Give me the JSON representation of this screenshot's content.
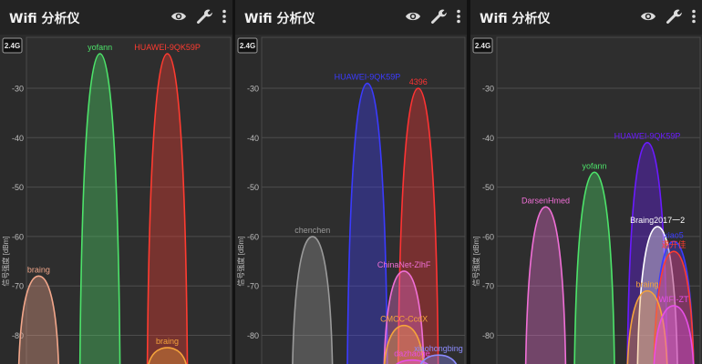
{
  "app": {
    "title": "Wifi 分析仪"
  },
  "toolbar_icons": [
    "eye-icon",
    "wrench-icon",
    "more-vert-icon"
  ],
  "band_label": "2.4G",
  "axis": {
    "ylabel": "信号强度 [dBm]",
    "ticks": [
      "-30",
      "-40",
      "-50",
      "-60",
      "-70",
      "-80"
    ]
  },
  "screens": [
    {
      "networks": [
        {
          "name": "braing",
          "dbm": -68,
          "color": "#f3a78b",
          "center": 0.06
        },
        {
          "name": "yofann",
          "dbm": -23,
          "color": "#4de36a",
          "center": 0.36
        },
        {
          "name": "HUAWEI-9QK59P",
          "dbm": -23,
          "color": "#ff3b30",
          "center": 0.69
        },
        {
          "name": "braing",
          "dbm": -82.5,
          "color": "#f5a33b",
          "center": 0.69
        }
      ]
    },
    {
      "networks": [
        {
          "name": "chenchen",
          "dbm": -60,
          "color": "#9a9a9a",
          "center": 0.25
        },
        {
          "name": "HUAWEI-9QK59P",
          "dbm": -29,
          "color": "#3b3bff",
          "center": 0.52
        },
        {
          "name": "4396",
          "dbm": -30,
          "color": "#ff3333",
          "center": 0.77
        },
        {
          "name": "ChinaNet-ZlhF",
          "dbm": -67,
          "color": "#f06fd6",
          "center": 0.7
        },
        {
          "name": "CMCC-CcdX",
          "dbm": -78,
          "color": "#f5a33b",
          "center": 0.7
        },
        {
          "name": "dazhaoge",
          "dbm": -85,
          "color": "#e64fe6",
          "center": 0.74
        },
        {
          "name": "xiaohongbing",
          "dbm": -84,
          "color": "#8c8cff",
          "center": 0.87
        }
      ]
    },
    {
      "networks": [
        {
          "name": "DarsenHmed",
          "dbm": -54,
          "color": "#f06fd6",
          "center": 0.24
        },
        {
          "name": "yofann",
          "dbm": -47,
          "color": "#4de36a",
          "center": 0.48
        },
        {
          "name": "HUAWEI-9QK59P",
          "dbm": -41,
          "color": "#6a1bff",
          "center": 0.74
        },
        {
          "name": "Braing2017一2",
          "dbm": -58,
          "color": "#ffffff",
          "center": 0.79
        },
        {
          "name": "xiao5",
          "dbm": -61,
          "color": "#3b3bff",
          "center": 0.87
        },
        {
          "name": "遇开佳",
          "dbm": -63,
          "color": "#ff3b30",
          "center": 0.87
        },
        {
          "name": "braing",
          "dbm": -71,
          "color": "#f5a33b",
          "center": 0.74
        },
        {
          "name": "WIFI-ZT",
          "dbm": -74,
          "color": "#e64fe6",
          "center": 0.87
        }
      ]
    }
  ]
}
